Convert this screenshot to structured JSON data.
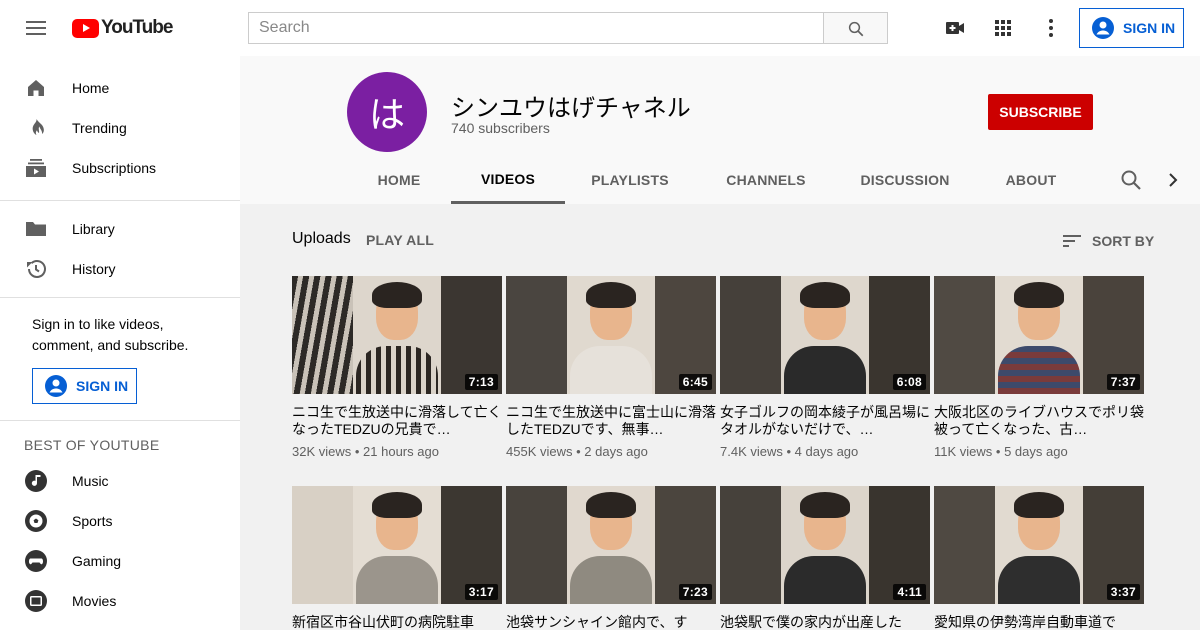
{
  "header": {
    "logo_text": "YouTube",
    "search_placeholder": "Search",
    "signin_label": "SIGN IN"
  },
  "sidebar": {
    "main_items": [
      {
        "label": "Home",
        "icon": "home-icon"
      },
      {
        "label": "Trending",
        "icon": "flame-icon"
      },
      {
        "label": "Subscriptions",
        "icon": "subscriptions-icon"
      }
    ],
    "library_items": [
      {
        "label": "Library",
        "icon": "folder-icon"
      },
      {
        "label": "History",
        "icon": "history-icon"
      }
    ],
    "signin_prompt": "Sign in to like videos, comment, and subscribe.",
    "signin_label": "SIGN IN",
    "best_heading": "BEST OF YOUTUBE",
    "best_items": [
      {
        "label": "Music",
        "icon": "music-icon"
      },
      {
        "label": "Sports",
        "icon": "sports-icon"
      },
      {
        "label": "Gaming",
        "icon": "gaming-icon"
      },
      {
        "label": "Movies",
        "icon": "movies-icon"
      }
    ]
  },
  "channel": {
    "avatar_letter": "は",
    "avatar_color": "#7b1fa2",
    "name": "シンユウはげチャネル",
    "subscribers": "740 subscribers",
    "subscribe_label": "SUBSCRIBE",
    "subscribe_color": "#cc0000",
    "tabs": [
      "HOME",
      "VIDEOS",
      "PLAYLISTS",
      "CHANNELS",
      "DISCUSSION",
      "ABOUT"
    ],
    "active_tab": "VIDEOS"
  },
  "content": {
    "section_title": "Uploads",
    "play_all_label": "PLAY ALL",
    "sort_label": "SORT BY",
    "videos": [
      {
        "duration": "7:13",
        "title": "ニコ生で生放送中に滑落して亡くなったTEDZUの兄貴で…",
        "views": "32K views",
        "age": "21 hours ago"
      },
      {
        "duration": "6:45",
        "title": "ニコ生で生放送中に富士山に滑落したTEDZUです、無事…",
        "views": "455K views",
        "age": "2 days ago"
      },
      {
        "duration": "6:08",
        "title": "女子ゴルフの岡本綾子が風呂場にタオルがないだけで、…",
        "views": "7.4K views",
        "age": "4 days ago"
      },
      {
        "duration": "7:37",
        "title": "大阪北区のライブハウスでポリ袋被って亡くなった、古…",
        "views": "11K views",
        "age": "5 days ago"
      },
      {
        "duration": "3:17",
        "title": "新宿区市谷山伏町の病院駐車",
        "views": "",
        "age": ""
      },
      {
        "duration": "7:23",
        "title": "池袋サンシャイン館内で、す",
        "views": "",
        "age": ""
      },
      {
        "duration": "4:11",
        "title": "池袋駅で僕の家内が出産した",
        "views": "",
        "age": ""
      },
      {
        "duration": "3:37",
        "title": "愛知県の伊勢湾岸自動車道で",
        "views": "",
        "age": ""
      }
    ]
  }
}
